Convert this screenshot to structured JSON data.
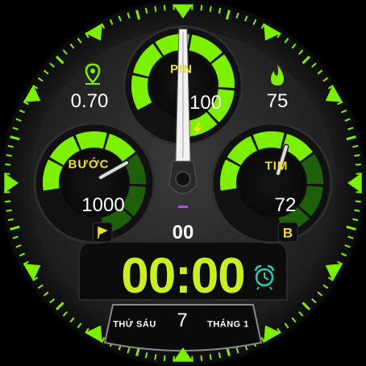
{
  "colors": {
    "accent": "#7df000",
    "gauge_dark": "#1f5f0a",
    "label_yellow": "#f0e020",
    "time_color": "#c8f020",
    "alarm_teal": "#1fd0b0",
    "battery_marker": "#c040ff"
  },
  "gauges": {
    "battery": {
      "label": "PIN",
      "value": "100",
      "level": 1.0,
      "icon": "lightning-icon"
    },
    "steps": {
      "label": "BƯỚC",
      "value": "1000",
      "level": 0.6,
      "icon": "flag-icon"
    },
    "heart": {
      "label": "TIM",
      "value": "72",
      "level": 0.55,
      "icon_letter": "B"
    }
  },
  "stats": {
    "distance": {
      "value": "0.70",
      "icon": "location-pin-icon"
    },
    "calories": {
      "value": "75",
      "icon": "flame-icon"
    }
  },
  "clock": {
    "time": "00:00",
    "seconds": "00",
    "alarm_icon": "alarm-clock-icon"
  },
  "date": {
    "weekday": "THỨ SÁU",
    "day": "7",
    "month": "THÁNG 1"
  }
}
